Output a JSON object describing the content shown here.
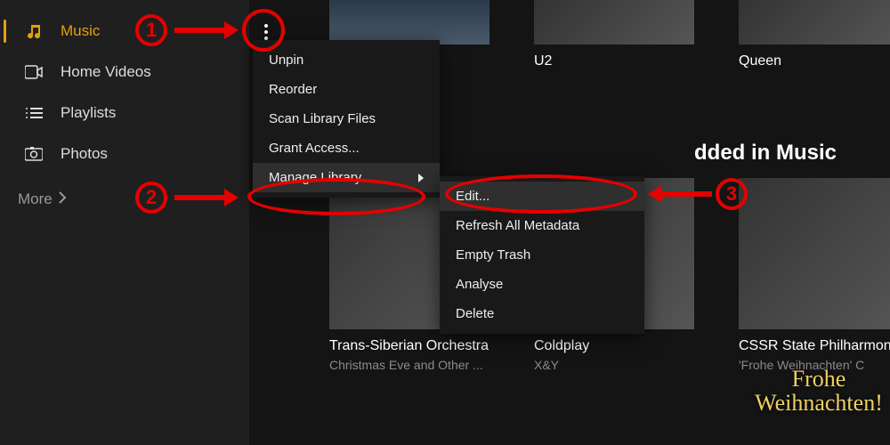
{
  "sidebar": {
    "items": [
      {
        "label": "Music",
        "icon": "music-icon",
        "active": true
      },
      {
        "label": "Home Videos",
        "icon": "video-icon",
        "active": false
      },
      {
        "label": "Playlists",
        "icon": "playlist-icon",
        "active": false
      },
      {
        "label": "Photos",
        "icon": "camera-icon",
        "active": false
      }
    ],
    "more_label": "More"
  },
  "top_row": {
    "u2": "U2",
    "queen": "Queen"
  },
  "section_heading_fragment": "dded in Music",
  "bottom_row": {
    "tso": {
      "title": "Trans-Siberian Orchestra",
      "sub": "Christmas Eve and Other ..."
    },
    "coldplay": {
      "title": "Coldplay",
      "sub": "X&Y"
    },
    "cssr": {
      "title": "CSSR State Philharmon",
      "sub": "'Frohe Weihnachten' C"
    },
    "frohe_overlay": "Frohe Weihnachten!"
  },
  "menu1": {
    "unpin": "Unpin",
    "reorder": "Reorder",
    "scan": "Scan Library Files",
    "grant": "Grant Access...",
    "manage": "Manage Library"
  },
  "menu2": {
    "edit": "Edit...",
    "refresh": "Refresh All Metadata",
    "empty": "Empty Trash",
    "analyse": "Analyse",
    "delete": "Delete"
  },
  "annotations": {
    "n1": "1",
    "n2": "2",
    "n3": "3"
  }
}
